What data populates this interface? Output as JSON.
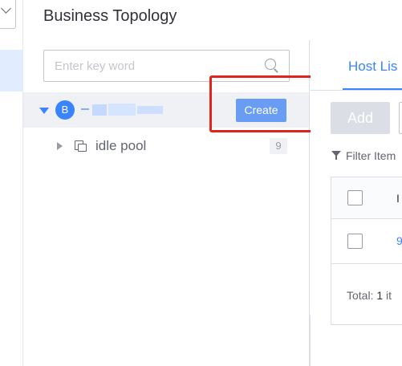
{
  "header": {
    "title": "Business Topology"
  },
  "search": {
    "placeholder": "Enter key word",
    "value": ""
  },
  "tree": {
    "business": {
      "avatar_letter": "B",
      "create_label": "Create"
    },
    "idle_pool": {
      "label": "idle pool",
      "count": "9"
    }
  },
  "host_panel": {
    "tab_label": "Host Lis",
    "add_label": "Add",
    "filter_label": "Filter Item",
    "table": {
      "column_header": "I",
      "rows": [
        {
          "ip": "9"
        }
      ],
      "total_prefix": "Total:",
      "total_count": "1",
      "total_suffix": "it"
    }
  },
  "colors": {
    "accent": "#3a84ff",
    "create_button": "#699df4",
    "highlight": "#e1251b",
    "selected_row": "#f0f1f5"
  }
}
